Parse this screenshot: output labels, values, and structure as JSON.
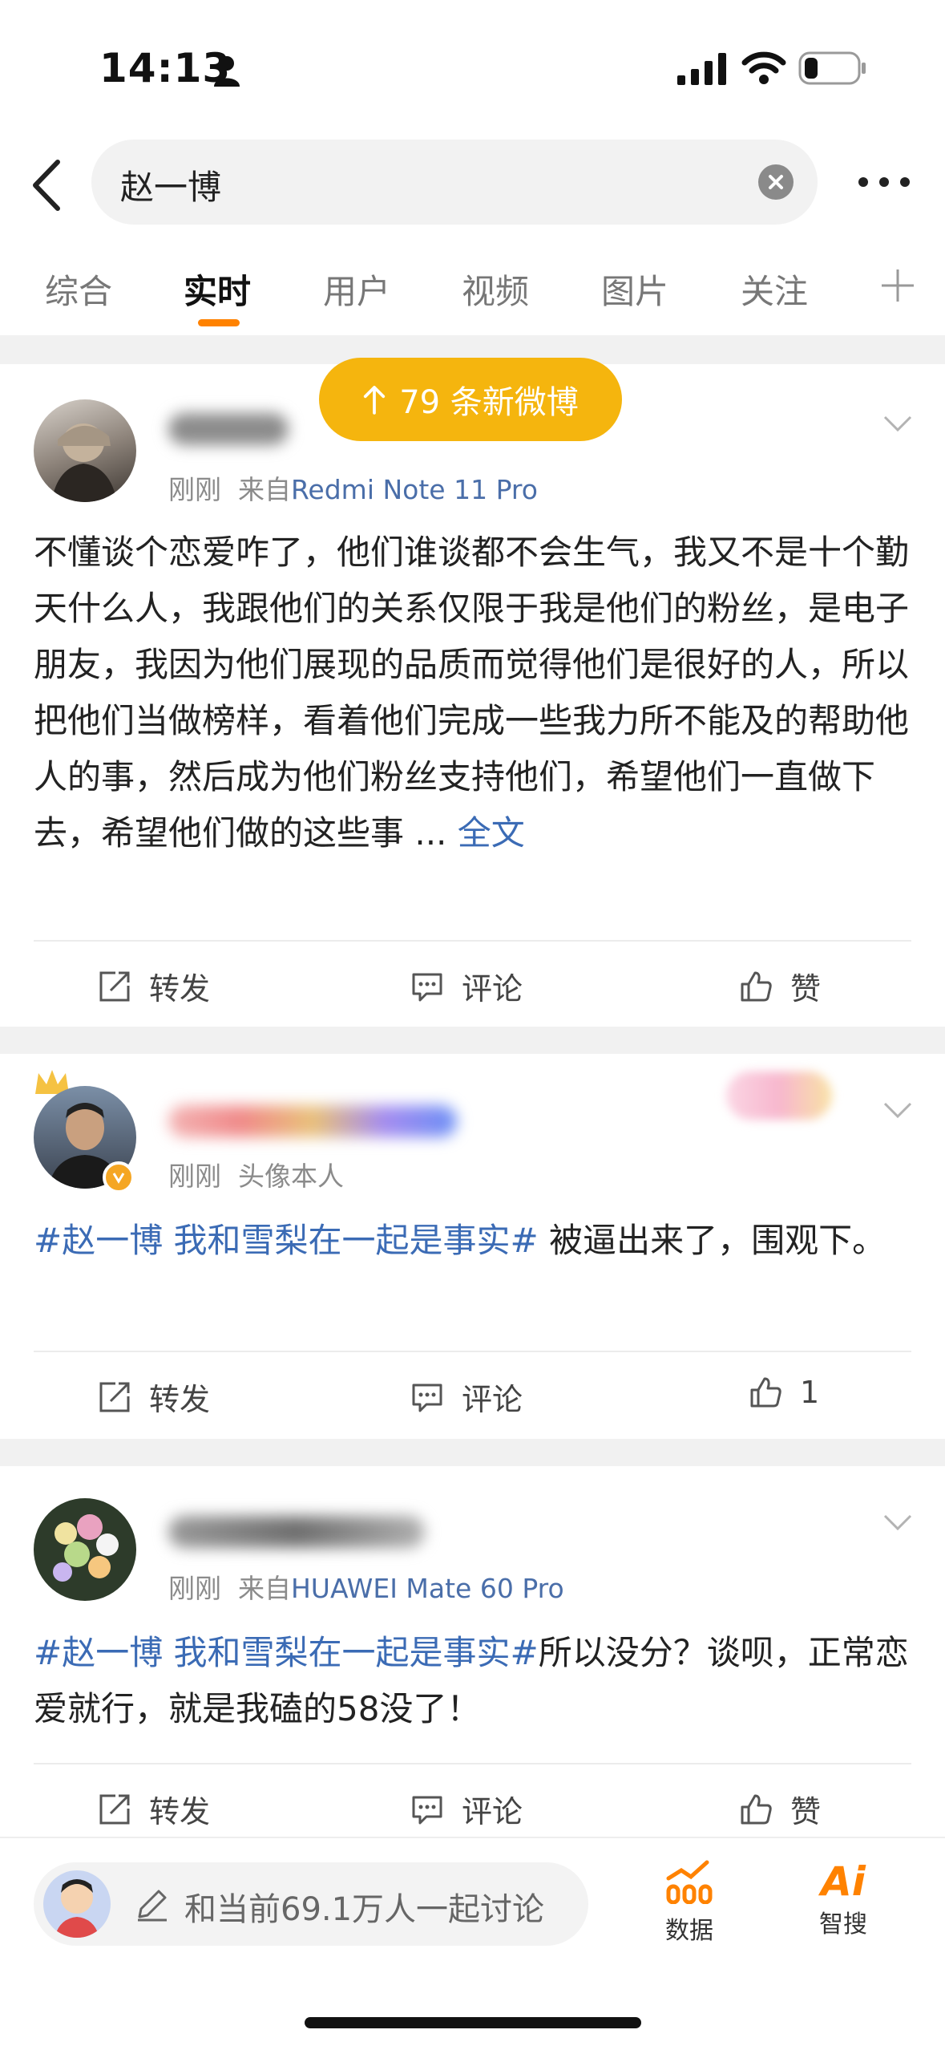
{
  "status": {
    "time": "14:13"
  },
  "search": {
    "query": "赵一博"
  },
  "tabs": [
    "综合",
    "实时",
    "用户",
    "视频",
    "图片",
    "关注"
  ],
  "new_posts": {
    "label": "79 条新微博"
  },
  "posts": [
    {
      "meta_time": "刚刚",
      "meta_from": "来自",
      "meta_source": "Redmi Note 11 Pro",
      "text": "不懂谈个恋爱咋了，他们谁谈都不会生气，我又不是十个勤天什么人，我跟他们的关系仅限于我是他们的粉丝，是电子朋友，我因为他们展现的品质而觉得他们是很好的人，所以把他们当做榜样，看着他们完成一些我力所不能及的帮助他人的事，然后成为他们粉丝支持他们，希望他们一直做下去，希望他们做的这些事 ...",
      "full_link": "全文",
      "actions": {
        "repost": "转发",
        "comment": "评论",
        "like": "赞"
      }
    },
    {
      "meta_time": "刚刚",
      "meta_note": "头像本人",
      "topic": "#赵一博 我和雪梨在一起是事实#",
      "text": " 被逼出来了，围观下。",
      "actions": {
        "repost": "转发",
        "comment": "评论",
        "like": "1"
      }
    },
    {
      "meta_time": "刚刚",
      "meta_from": "来自",
      "meta_source": "HUAWEI Mate 60 Pro",
      "topic": "#赵一博 我和雪梨在一起是事实#",
      "text": "所以没分？谈呗，正常恋爱就行，就是我磕的58没了！",
      "actions": {
        "repost": "转发",
        "comment": "评论",
        "like": "赞"
      }
    }
  ],
  "bottom": {
    "discuss_placeholder": "和当前69.1万人一起讨论",
    "data_label": "数据",
    "ai_label": "智搜",
    "ai_logo": "Ai"
  },
  "colors": {
    "accent": "#ff8200",
    "pill": "#f5b50e",
    "link": "#3b6bb5"
  }
}
